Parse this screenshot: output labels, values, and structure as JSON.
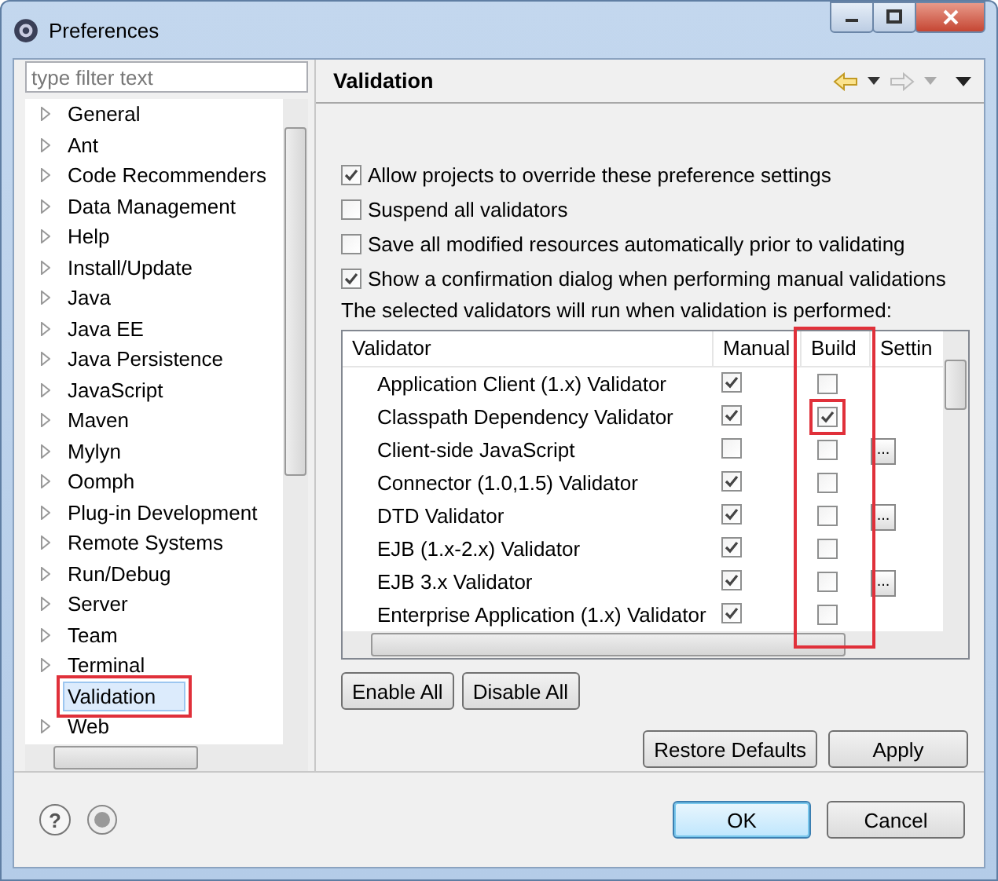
{
  "window": {
    "title": "Preferences"
  },
  "filter": {
    "placeholder": "type filter text"
  },
  "tree": [
    {
      "label": "General",
      "expandable": true,
      "selected": false,
      "highlighted": false
    },
    {
      "label": "Ant",
      "expandable": true,
      "selected": false,
      "highlighted": false
    },
    {
      "label": "Code Recommenders",
      "expandable": true,
      "selected": false,
      "highlighted": false
    },
    {
      "label": "Data Management",
      "expandable": true,
      "selected": false,
      "highlighted": false
    },
    {
      "label": "Help",
      "expandable": true,
      "selected": false,
      "highlighted": false
    },
    {
      "label": "Install/Update",
      "expandable": true,
      "selected": false,
      "highlighted": false
    },
    {
      "label": "Java",
      "expandable": true,
      "selected": false,
      "highlighted": false
    },
    {
      "label": "Java EE",
      "expandable": true,
      "selected": false,
      "highlighted": false
    },
    {
      "label": "Java Persistence",
      "expandable": true,
      "selected": false,
      "highlighted": false
    },
    {
      "label": "JavaScript",
      "expandable": true,
      "selected": false,
      "highlighted": false
    },
    {
      "label": "Maven",
      "expandable": true,
      "selected": false,
      "highlighted": false
    },
    {
      "label": "Mylyn",
      "expandable": true,
      "selected": false,
      "highlighted": false
    },
    {
      "label": "Oomph",
      "expandable": true,
      "selected": false,
      "highlighted": false
    },
    {
      "label": "Plug-in Development",
      "expandable": true,
      "selected": false,
      "highlighted": false
    },
    {
      "label": "Remote Systems",
      "expandable": true,
      "selected": false,
      "highlighted": false
    },
    {
      "label": "Run/Debug",
      "expandable": true,
      "selected": false,
      "highlighted": false
    },
    {
      "label": "Server",
      "expandable": true,
      "selected": false,
      "highlighted": false
    },
    {
      "label": "Team",
      "expandable": true,
      "selected": false,
      "highlighted": false
    },
    {
      "label": "Terminal",
      "expandable": true,
      "selected": false,
      "highlighted": false
    },
    {
      "label": "Validation",
      "expandable": false,
      "selected": true,
      "highlighted": true
    },
    {
      "label": "Web",
      "expandable": true,
      "selected": false,
      "highlighted": false
    }
  ],
  "page": {
    "title": "Validation",
    "back_disabled": false,
    "forward_disabled": true
  },
  "options": [
    {
      "label": "Allow projects to override these preference settings",
      "checked": true
    },
    {
      "label": "Suspend all validators",
      "checked": false
    },
    {
      "label": "Save all modified resources automatically prior to validating",
      "checked": false
    },
    {
      "label": "Show a confirmation dialog when performing manual validations",
      "checked": true
    }
  ],
  "note": "The selected validators will run when validation is performed:",
  "table": {
    "columns": [
      "Validator",
      "Manual",
      "Build",
      "Settin"
    ],
    "build_column_highlighted": true,
    "rows": [
      {
        "name": "Application Client (1.x) Validator",
        "manual": true,
        "build": false,
        "settings": false,
        "highlighted": false
      },
      {
        "name": "Classpath Dependency Validator",
        "manual": true,
        "build": true,
        "settings": false,
        "highlighted": true
      },
      {
        "name": "Client-side JavaScript",
        "manual": false,
        "build": false,
        "settings": true,
        "highlighted": false
      },
      {
        "name": "Connector (1.0,1.5) Validator",
        "manual": true,
        "build": false,
        "settings": false,
        "highlighted": false
      },
      {
        "name": "DTD Validator",
        "manual": true,
        "build": false,
        "settings": true,
        "highlighted": false
      },
      {
        "name": "EJB (1.x-2.x) Validator",
        "manual": true,
        "build": false,
        "settings": false,
        "highlighted": false
      },
      {
        "name": "EJB 3.x Validator",
        "manual": true,
        "build": false,
        "settings": true,
        "highlighted": false
      },
      {
        "name": "Enterprise Application (1.x) Validator",
        "manual": true,
        "build": false,
        "settings": false,
        "highlighted": false
      }
    ]
  },
  "settings_button": "...",
  "table_buttons": [
    "Enable All",
    "Disable All"
  ],
  "page_buttons": [
    "Restore Defaults",
    "Apply"
  ],
  "help_button": "?",
  "dialog_buttons": [
    {
      "label": "OK",
      "default": true
    },
    {
      "label": "Cancel",
      "default": false
    }
  ]
}
